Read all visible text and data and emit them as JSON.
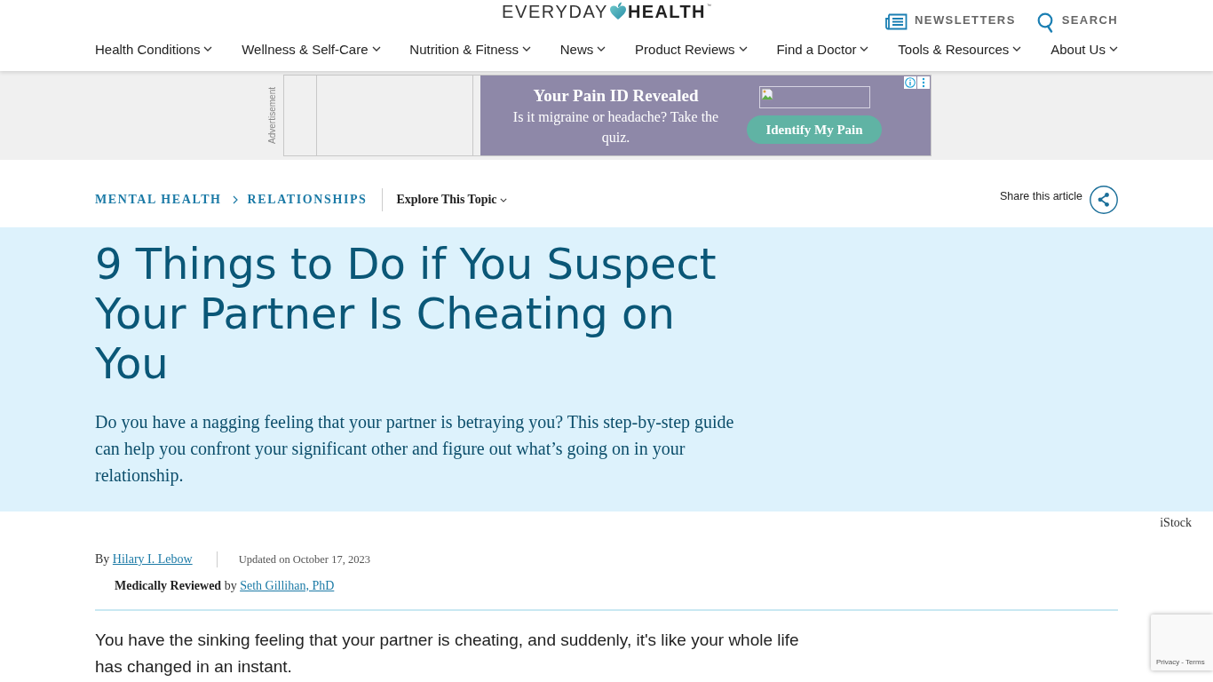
{
  "header": {
    "logo": {
      "word_1": "EVERYDAY",
      "word_2": "HEALTH",
      "mark": "™"
    },
    "utility_links": [
      {
        "kind": "newsletters",
        "label": "NEWSLETTERS"
      },
      {
        "kind": "search",
        "label": "SEARCH"
      }
    ],
    "nav": [
      {
        "label": "Health Conditions"
      },
      {
        "label": "Wellness & Self-Care"
      },
      {
        "label": "Nutrition & Fitness"
      },
      {
        "label": "News"
      },
      {
        "label": "Product Reviews"
      },
      {
        "label": "Find a Doctor"
      },
      {
        "label": "Tools & Resources"
      },
      {
        "label": "About Us"
      }
    ]
  },
  "advertisement": {
    "label": "Advertisement",
    "title": "Your Pain ID Revealed",
    "text": "Is it migraine or headache? Take the quiz.",
    "button": "Identify My Pain"
  },
  "topic_bar": {
    "breadcrumbs": [
      {
        "label": "MENTAL HEALTH"
      },
      {
        "label": "RELATIONSHIPS"
      }
    ],
    "explore": "Explore This Topic",
    "share": "Share this article"
  },
  "article": {
    "title": "9 Things to Do if You Suspect Your Partner Is Cheating on You",
    "dek": "Do you have a nagging feeling that your partner is betraying you? This step-by-step guide can help you confront your significant other and figure out what’s going on in your relationship.",
    "image_credit": "iStock",
    "byline": {
      "prefix": "By",
      "author": "Hilary I. Lebow",
      "updated": "Updated on October 17, 2023",
      "review_label": "**Medically Reviewed** by",
      "reviewer": "Seth Gillihan, PhD"
    },
    "body": [
      "You have the sinking feeling that your partner is cheating, and suddenly, it's like your whole life has changed in an instant."
    ]
  },
  "recaptcha": {
    "links": [
      "Privacy",
      "Terms"
    ],
    "separator": "-"
  }
}
